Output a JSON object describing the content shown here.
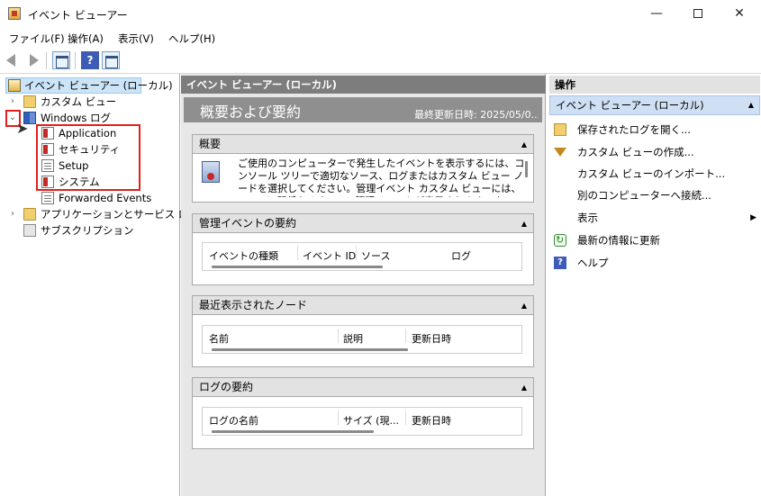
{
  "window": {
    "title": "イベント ビューアー",
    "minimize": "—",
    "close": "✕"
  },
  "menu": [
    "ファイル(F)",
    "操作(A)",
    "表示(V)",
    "ヘルプ(H)"
  ],
  "toolbar": {
    "help_glyph": "?"
  },
  "tree": {
    "root": "イベント ビューアー (ローカル)",
    "custom_views": "カスタム ビュー",
    "windows_logs": "Windows ログ",
    "logs": [
      "Application",
      "セキュリティ",
      "Setup",
      "システム",
      "Forwarded Events"
    ],
    "app_service_logs": "アプリケーションとサービス ログ",
    "subscriptions": "サブスクリプション"
  },
  "center": {
    "header": "イベント ビューアー (ローカル)",
    "summary_title": "概要および要約",
    "last_updated": "最終更新日時: 2025/05/0...",
    "overview": {
      "title": "概要",
      "text": "ご使用のコンピューターで発生したイベントを表示するには、コンソール ツリーで適切なソース、ログまたはカスタム ビュー ノードを選択してください。管理イベント カスタム ビューには、ソースに関係なくすべての管理イベントが表示されます。すべてのログを集"
    },
    "admin_events": {
      "title": "管理イベントの要約",
      "columns": [
        "イベントの種類",
        "イベント ID",
        "ソース",
        "ログ"
      ]
    },
    "recent_nodes": {
      "title": "最近表示されたノード",
      "columns": [
        "名前",
        "説明",
        "更新日時"
      ]
    },
    "log_summary": {
      "title": "ログの要約",
      "columns": [
        "ログの名前",
        "サイズ (現...",
        "更新日時"
      ]
    }
  },
  "actions": {
    "header": "操作",
    "subheader": "イベント ビューアー (ローカル)",
    "items": [
      {
        "label": "保存されたログを開く...",
        "icon": "folder-open-icon"
      },
      {
        "label": "カスタム ビューの作成...",
        "icon": "filter-icon"
      },
      {
        "label": "カスタム ビューのインポート...",
        "icon": "none"
      },
      {
        "label": "別のコンピューターへ接続...",
        "icon": "none"
      },
      {
        "label": "表示",
        "icon": "none"
      },
      {
        "label": "最新の情報に更新",
        "icon": "refresh-icon"
      },
      {
        "label": "ヘルプ",
        "icon": "help-icon"
      }
    ]
  },
  "colors": {
    "highlight_red": "#e0201c",
    "selection_blue": "#cce4f7",
    "header_gray": "#7d7d7d"
  }
}
